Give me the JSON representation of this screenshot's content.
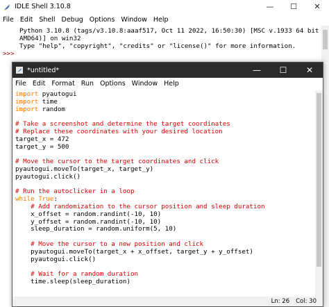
{
  "shell": {
    "title": "IDLE Shell 3.10.8",
    "controls": {
      "minimize": "—",
      "maximize": "☐",
      "close": "✕"
    },
    "menu": [
      "File",
      "Edit",
      "Shell",
      "Debug",
      "Options",
      "Window",
      "Help"
    ],
    "lines": [
      "Python 3.10.8 (tags/v3.10.8:aaaf517, Oct 11 2022, 16:50:30) [MSC v.1933 64 bit (",
      "AMD64)] on win32",
      "Type \"help\", \"copyright\", \"credits\" or \"license()\" for more information."
    ],
    "prompt": ">>>"
  },
  "editor": {
    "title": "*untitled*",
    "controls": {
      "minimize": "—",
      "maximize": "☐",
      "close": "✕"
    },
    "menu": [
      "File",
      "Edit",
      "Format",
      "Run",
      "Options",
      "Window",
      "Help"
    ],
    "code": [
      [
        {
          "t": "import",
          "c": "kw"
        },
        {
          "t": " pyautogui"
        }
      ],
      [
        {
          "t": "import",
          "c": "kw"
        },
        {
          "t": " time"
        }
      ],
      [
        {
          "t": "import",
          "c": "kw"
        },
        {
          "t": " random"
        }
      ],
      [],
      [
        {
          "t": "# Take a screenshot and determine the target coordinates",
          "c": "cm"
        }
      ],
      [
        {
          "t": "# Replace these coordinates with your desired location",
          "c": "cm"
        }
      ],
      [
        {
          "t": "target_x = 472"
        }
      ],
      [
        {
          "t": "target_y = 500"
        }
      ],
      [],
      [
        {
          "t": "# Move the cursor to the target coordinates and click",
          "c": "cm"
        }
      ],
      [
        {
          "t": "pyautogui.moveTo(target_x, target_y)"
        }
      ],
      [
        {
          "t": "pyautogui.click()"
        }
      ],
      [],
      [
        {
          "t": "# Run the autoclicker in a loop",
          "c": "cm"
        }
      ],
      [
        {
          "t": "while",
          "c": "kw"
        },
        {
          "t": " "
        },
        {
          "t": "True",
          "c": "kw"
        },
        {
          "t": ":"
        }
      ],
      [
        {
          "t": "    "
        },
        {
          "t": "# Add randomization to the cursor position and sleep duration",
          "c": "cm"
        }
      ],
      [
        {
          "t": "    x_offset = random.randint(-10, 10)"
        }
      ],
      [
        {
          "t": "    y_offset = random.randint(-10, 10)"
        }
      ],
      [
        {
          "t": "    sleep_duration = random.uniform(5, 10)"
        }
      ],
      [],
      [
        {
          "t": "    "
        },
        {
          "t": "# Move the cursor to a new position and click",
          "c": "cm"
        }
      ],
      [
        {
          "t": "    pyautogui.moveTo(target_x + x_offset, target_y + y_offset)"
        }
      ],
      [
        {
          "t": "    pyautogui.click()"
        }
      ],
      [],
      [
        {
          "t": "    "
        },
        {
          "t": "# Wait for a random duration",
          "c": "cm"
        }
      ],
      [
        {
          "t": "    time.sleep(sleep_duration)"
        }
      ]
    ],
    "status": {
      "line": "Ln: 26",
      "col": "Col: 30"
    }
  }
}
